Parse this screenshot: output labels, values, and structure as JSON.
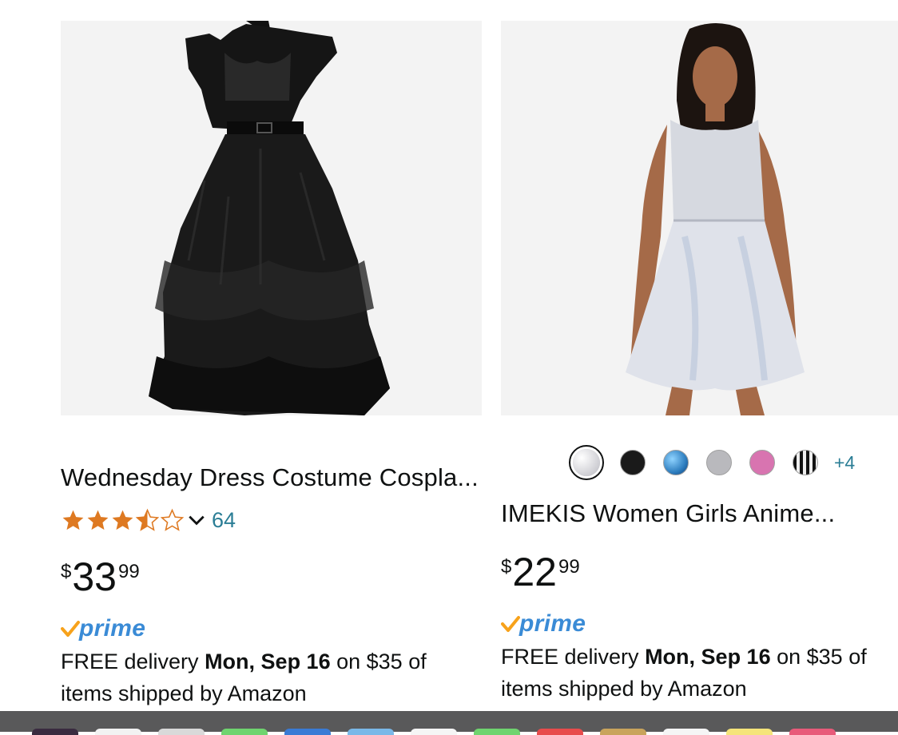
{
  "products": [
    {
      "title": "Wednesday Dress Costume Cospla...",
      "rating_value": 3.5,
      "rating_max": 5,
      "review_count": "64",
      "price": {
        "symbol": "$",
        "whole": "33",
        "fraction": "99"
      },
      "prime_label": "prime",
      "delivery": {
        "prefix": "FREE delivery",
        "date": "Mon, Sep 16",
        "suffix": "on $35 of items shipped by Amazon"
      }
    },
    {
      "title": "IMEKIS Women Girls Anime...",
      "swatch_colors": [
        "#c8c8ce",
        "#1a1a1a",
        "#2f7fc0",
        "#b9b9bd",
        "#d874b0",
        "#7a7a7a"
      ],
      "more_swatches": "+4",
      "price": {
        "symbol": "$",
        "whole": "22",
        "fraction": "99"
      },
      "prime_label": "prime",
      "delivery": {
        "prefix": "FREE delivery",
        "date": "Mon, Sep 16",
        "suffix": "on $35 of items shipped by Amazon"
      }
    }
  ],
  "colors": {
    "star": "#de7921",
    "link": "#2a7d95",
    "prime_blue": "#3a8bd6",
    "prime_check": "#f7a21b",
    "image_bg": "#f3f3f3"
  },
  "dock_icon_colors": [
    "#3a2b40",
    "#f2f2f2",
    "#d9d9d9",
    "#6fd46f",
    "#3a7bd5",
    "#7ab8e8",
    "#f5f5f5",
    "#6fd46f",
    "#e84c4c",
    "#c9a45c",
    "#f5f5f5",
    "#f5e47a",
    "#e85b7a"
  ]
}
